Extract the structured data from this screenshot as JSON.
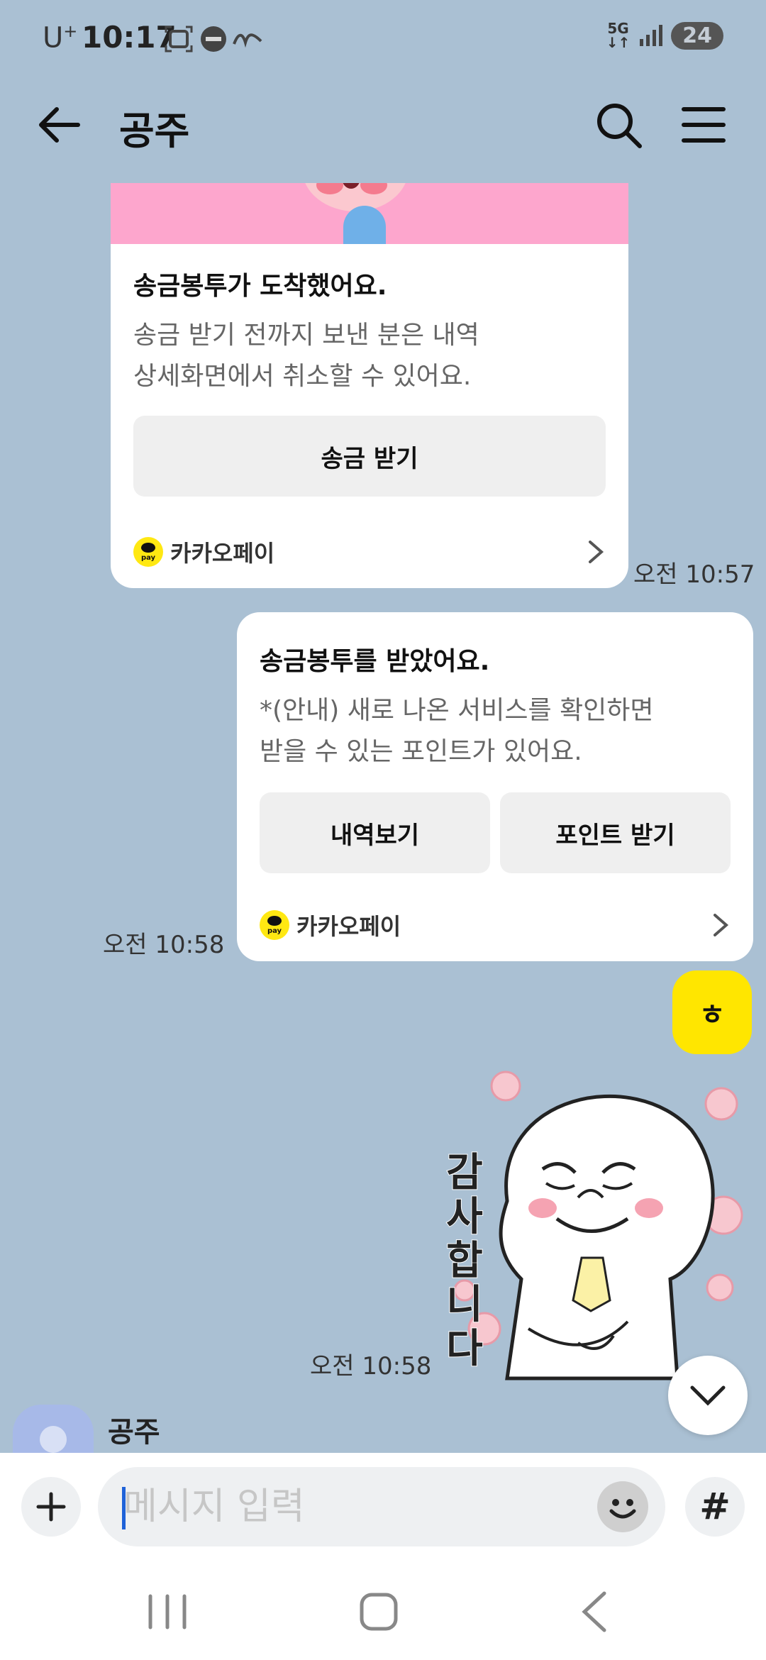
{
  "status_bar": {
    "carrier": "U",
    "carrier_sup": "+",
    "time": "10:17",
    "network": "5G",
    "battery": "24"
  },
  "header": {
    "title": "공주"
  },
  "messages": {
    "card_received": {
      "title": "송금봉투가 도착했어요.",
      "desc_line1": "송금 받기 전까지 보낸 분은 내역",
      "desc_line2": "상세화면에서 취소할 수 있어요.",
      "button": "송금 받기",
      "brand": "카카오페이",
      "time": "오전 10:57"
    },
    "card_accepted": {
      "title": "송금봉투를 받았어요.",
      "desc_line1": "*(안내) 새로 나온 서비스를 확인하면",
      "desc_line2": "받을 수 있는 포인트가 있어요.",
      "button_history": "내역보기",
      "button_points": "포인트 받기",
      "brand": "카카오페이",
      "time": "오전 10:58"
    },
    "my_text": "ㅎ",
    "sticker_text": "감사합니다",
    "sticker_time": "오전 10:58",
    "next_sender": "공주"
  },
  "input": {
    "placeholder": "메시지 입력",
    "hash": "#"
  },
  "colors": {
    "chat_bg": "#aac0d3",
    "my_bubble": "#ffe600",
    "kakaopay": "#ffe812"
  }
}
